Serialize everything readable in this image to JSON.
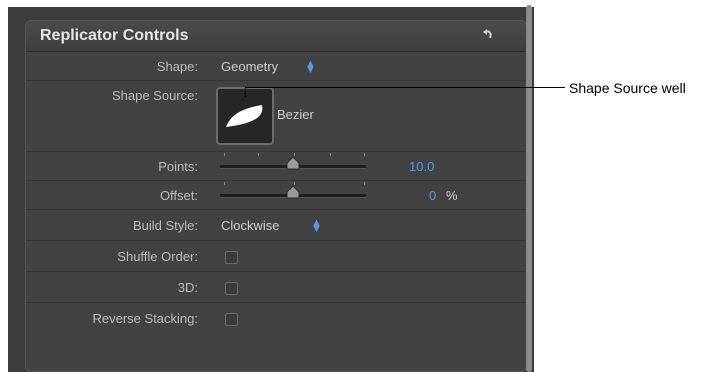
{
  "panel": {
    "title": "Replicator Controls",
    "reset_icon": "reset-arrow-icon"
  },
  "rows": {
    "shape": {
      "label": "Shape:",
      "value": "Geometry"
    },
    "shape_source": {
      "label": "Shape Source:",
      "value": "Bezier"
    },
    "points": {
      "label": "Points:",
      "value": "10.0",
      "level": 0.5
    },
    "offset": {
      "label": "Offset:",
      "value": "0",
      "unit": "%",
      "level": 0.5
    },
    "build_style": {
      "label": "Build Style:",
      "value": "Clockwise"
    },
    "shuffle_order": {
      "label": "Shuffle Order:",
      "checked": false
    },
    "three_d": {
      "label": "3D:",
      "checked": false
    },
    "reverse_stacking": {
      "label": "Reverse Stacking:",
      "checked": false
    }
  },
  "callout": {
    "text": "Shape Source well"
  },
  "colors": {
    "panel_bg": "#3c3c3c",
    "accent_blue": "#5b9bdc"
  }
}
